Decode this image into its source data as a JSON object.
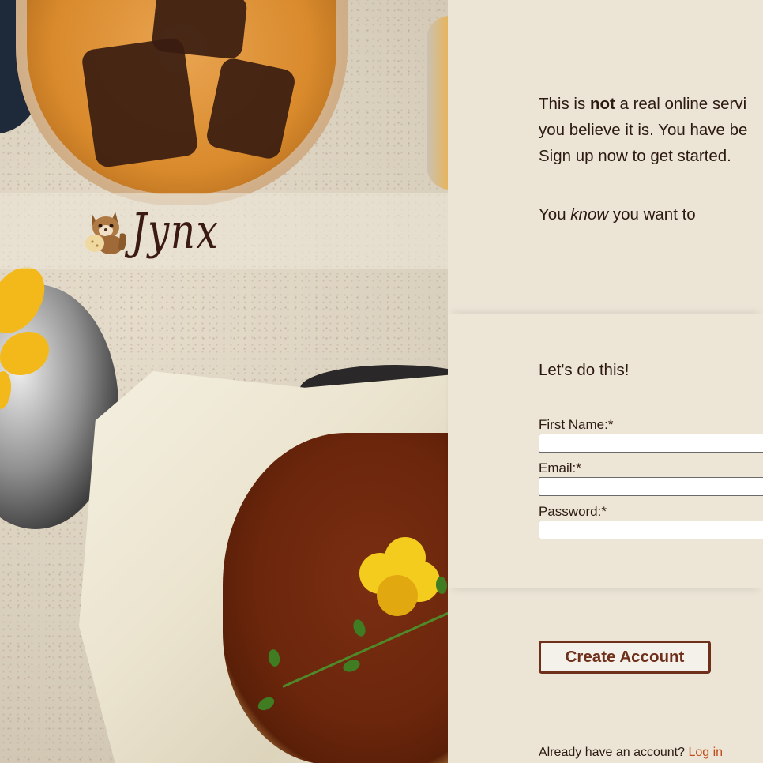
{
  "brand": {
    "logo_text": "Jynx",
    "mascot_icon": "squirrel-mascot-icon"
  },
  "intro": {
    "line1_pre": "This is ",
    "line1_bold": "not",
    "line1_post": " a real online servi",
    "line2": "you believe it is. You have be",
    "line3": "Sign up now to get started.",
    "know_pre": "You ",
    "know_em": "know",
    "know_post": " you want to"
  },
  "form": {
    "title": "Let's do this!",
    "first_name_label": "First Name:*",
    "email_label": "Email:*",
    "password_label": "Password:*",
    "first_name_value": "",
    "email_value": "",
    "password_value": ""
  },
  "actions": {
    "create_account": "Create Account",
    "login_prompt": "Already have an account? ",
    "login_link": "Log in"
  },
  "colors": {
    "page_bg": "#ece5d6",
    "text": "#2c1a12",
    "accent": "#6e2f1b",
    "link": "#c24a1a"
  }
}
